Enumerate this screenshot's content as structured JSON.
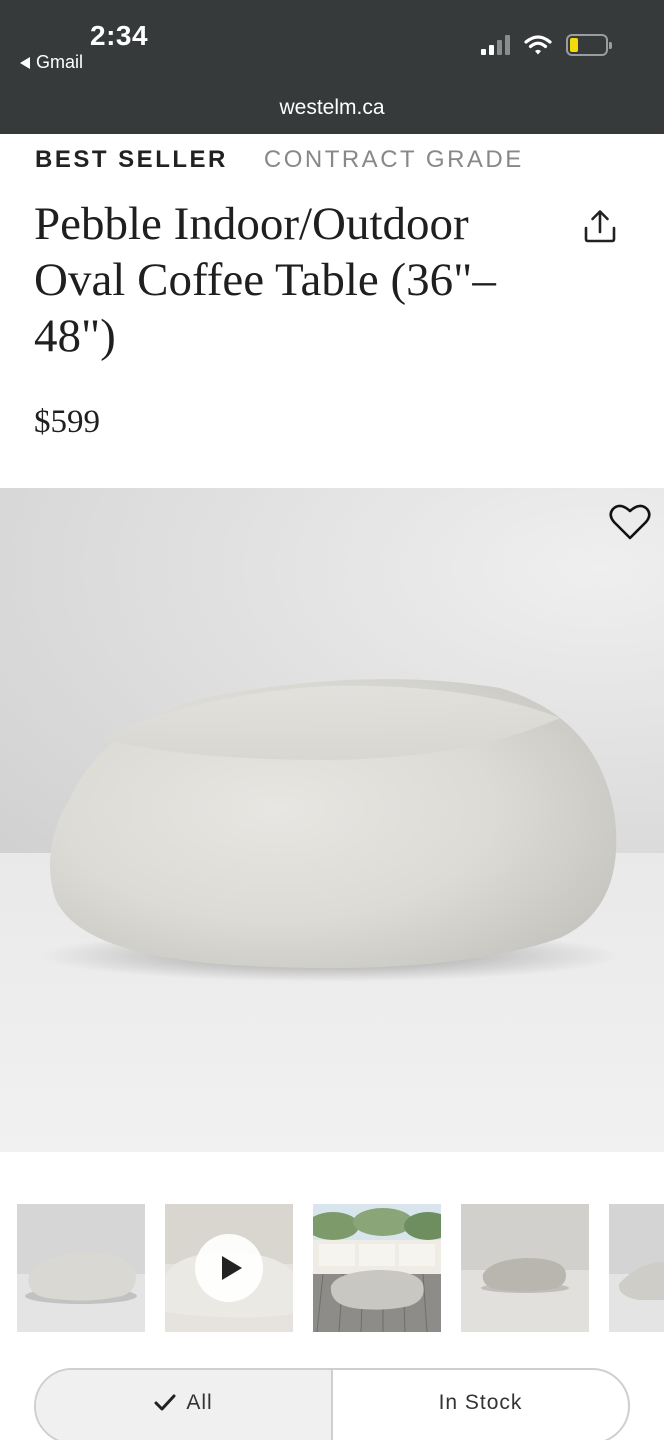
{
  "status_bar": {
    "time": "2:34",
    "back_app": "Gmail",
    "url": "westelm.ca",
    "battery_color": "#f5d90a"
  },
  "product": {
    "badges": [
      "BEST SELLER",
      "CONTRACT GRADE"
    ],
    "title": "Pebble Indoor/Outdoor Oval Coffee Table (36\"–48\")",
    "price": "$599",
    "icons": {
      "share": "share-icon",
      "favorite": "heart-icon"
    }
  },
  "gallery": {
    "thumbnails": [
      {
        "name": "pebble-table-studio",
        "selected": true
      },
      {
        "name": "pebble-table-video",
        "video": true
      },
      {
        "name": "pebble-table-outdoor-scene"
      },
      {
        "name": "pebble-table-grey-studio"
      },
      {
        "name": "pebble-table-partial"
      }
    ]
  },
  "filter": {
    "options": [
      "All",
      "In Stock"
    ],
    "selected": "All"
  }
}
